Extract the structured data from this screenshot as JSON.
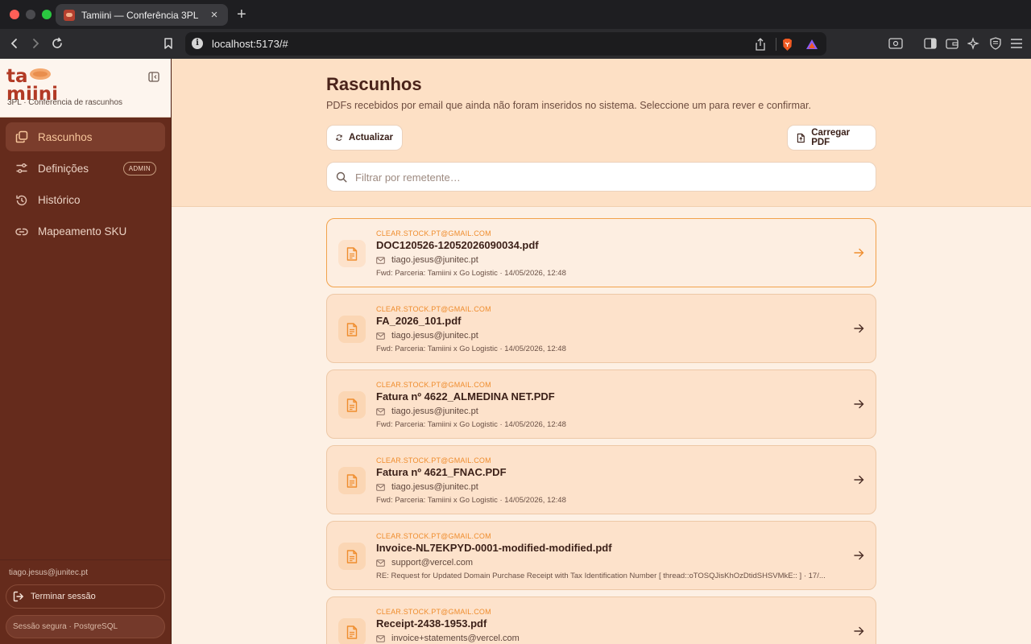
{
  "browser": {
    "tab_title": "Tamiini — Conferência 3PL",
    "url": "localhost:5173/#"
  },
  "sidebar": {
    "logo_text": "tamiini",
    "subtitle": "3PL · Conferência de rascunhos",
    "nav": [
      {
        "label": "Rascunhos",
        "icon": "copy-icon",
        "active": true
      },
      {
        "label": "Definições",
        "icon": "sliders-icon",
        "badge": "ADMIN"
      },
      {
        "label": "Histórico",
        "icon": "history-icon"
      },
      {
        "label": "Mapeamento SKU",
        "icon": "link-icon"
      }
    ],
    "user_email": "tiago.jesus@junitec.pt",
    "logout_label": "Terminar sessão",
    "session_label": "Sessão segura · PostgreSQL"
  },
  "main": {
    "title": "Rascunhos",
    "description": "PDFs recebidos por email que ainda não foram inseridos no sistema. Seleccione um para rever e confirmar.",
    "refresh_label": "Actualizar",
    "upload_label": "Carregar PDF",
    "search_placeholder": "Filtrar por remetente…",
    "drafts": [
      {
        "sender": "CLEAR.STOCK.PT@GMAIL.COM",
        "file": "DOC120526-12052026090034.pdf",
        "from": "tiago.jesus@junitec.pt",
        "subject": "Fwd: Parceria: Tamiini x Go Logistic · 14/05/2026, 12:48"
      },
      {
        "sender": "CLEAR.STOCK.PT@GMAIL.COM",
        "file": "FA_2026_101.pdf",
        "from": "tiago.jesus@junitec.pt",
        "subject": "Fwd: Parceria: Tamiini x Go Logistic · 14/05/2026, 12:48"
      },
      {
        "sender": "CLEAR.STOCK.PT@GMAIL.COM",
        "file": "Fatura nº 4622_ALMEDINA NET.PDF",
        "from": "tiago.jesus@junitec.pt",
        "subject": "Fwd: Parceria: Tamiini x Go Logistic · 14/05/2026, 12:48"
      },
      {
        "sender": "CLEAR.STOCK.PT@GMAIL.COM",
        "file": "Fatura nº 4621_FNAC.PDF",
        "from": "tiago.jesus@junitec.pt",
        "subject": "Fwd: Parceria: Tamiini x Go Logistic · 14/05/2026, 12:48"
      },
      {
        "sender": "CLEAR.STOCK.PT@GMAIL.COM",
        "file": "Invoice-NL7EKPYD-0001-modified-modified.pdf",
        "from": "support@vercel.com",
        "subject": "RE: Request for Updated Domain Purchase Receipt with Tax Identification Number [ thread::oTOSQJisKhOzDtidSHSVMkE:: ] · 17/..."
      },
      {
        "sender": "CLEAR.STOCK.PT@GMAIL.COM",
        "file": "Receipt-2438-1953.pdf",
        "from": "invoice+statements@vercel.com",
        "subject": ""
      }
    ]
  },
  "colors": {
    "sidebar_bg": "#652b1c",
    "accent": "#ef8d2e",
    "hero_bg": "#fde0c5"
  }
}
